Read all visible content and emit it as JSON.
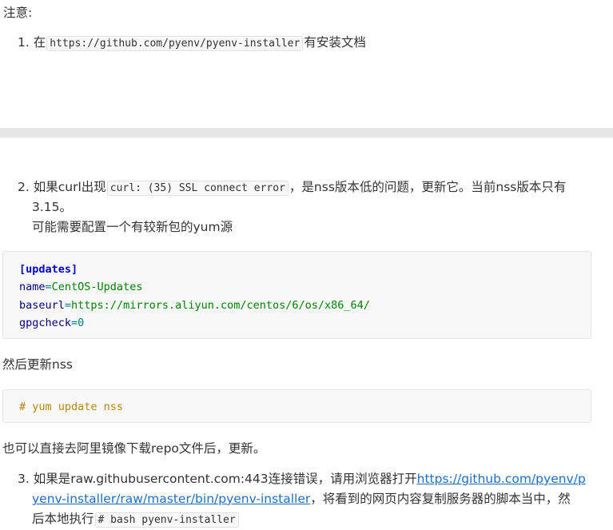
{
  "note_label": "注意:",
  "item1": {
    "num": "1.",
    "pre": "在",
    "code": "https://github.com/pyenv/pyenv-installer",
    "post": "有安装文档"
  },
  "item2": {
    "num": "2.",
    "pre": "如果curl出现",
    "code": "curl: (35) SSL connect error",
    "post": "，是nss版本低的问题，更新它。当前nss版本只有",
    "line2": "3.15。",
    "line3": "可能需要配置一个有较新包的yum源"
  },
  "repo_block": {
    "section": "[updates]",
    "lines": [
      {
        "key": "name",
        "eq": "=",
        "val": "CentOS-Updates"
      },
      {
        "key": "baseurl",
        "eq": "=",
        "val": "https://mirrors.aliyun.com/centos/6/os/x86_64/"
      },
      {
        "key": "gpgcheck",
        "eq": "=",
        "val": "0"
      }
    ]
  },
  "then_text": "然后更新nss",
  "cmd_block": "# yum update nss",
  "also_text": "也可以直接去阿里镜像下载repo文件后，更新。",
  "item3": {
    "num": "3.",
    "pre": "如果是raw.githubusercontent.com:443连接错误，请用浏览器打开",
    "link_part1": "https://github.com/pyenv/p",
    "link_part2": "yenv-installer/raw/master/bin/pyenv-installer",
    "post": "，将看到的网页内容复制服务器的脚本当中，然",
    "line3_pre": "后本地执行",
    "code": "# bash pyenv-installer"
  }
}
